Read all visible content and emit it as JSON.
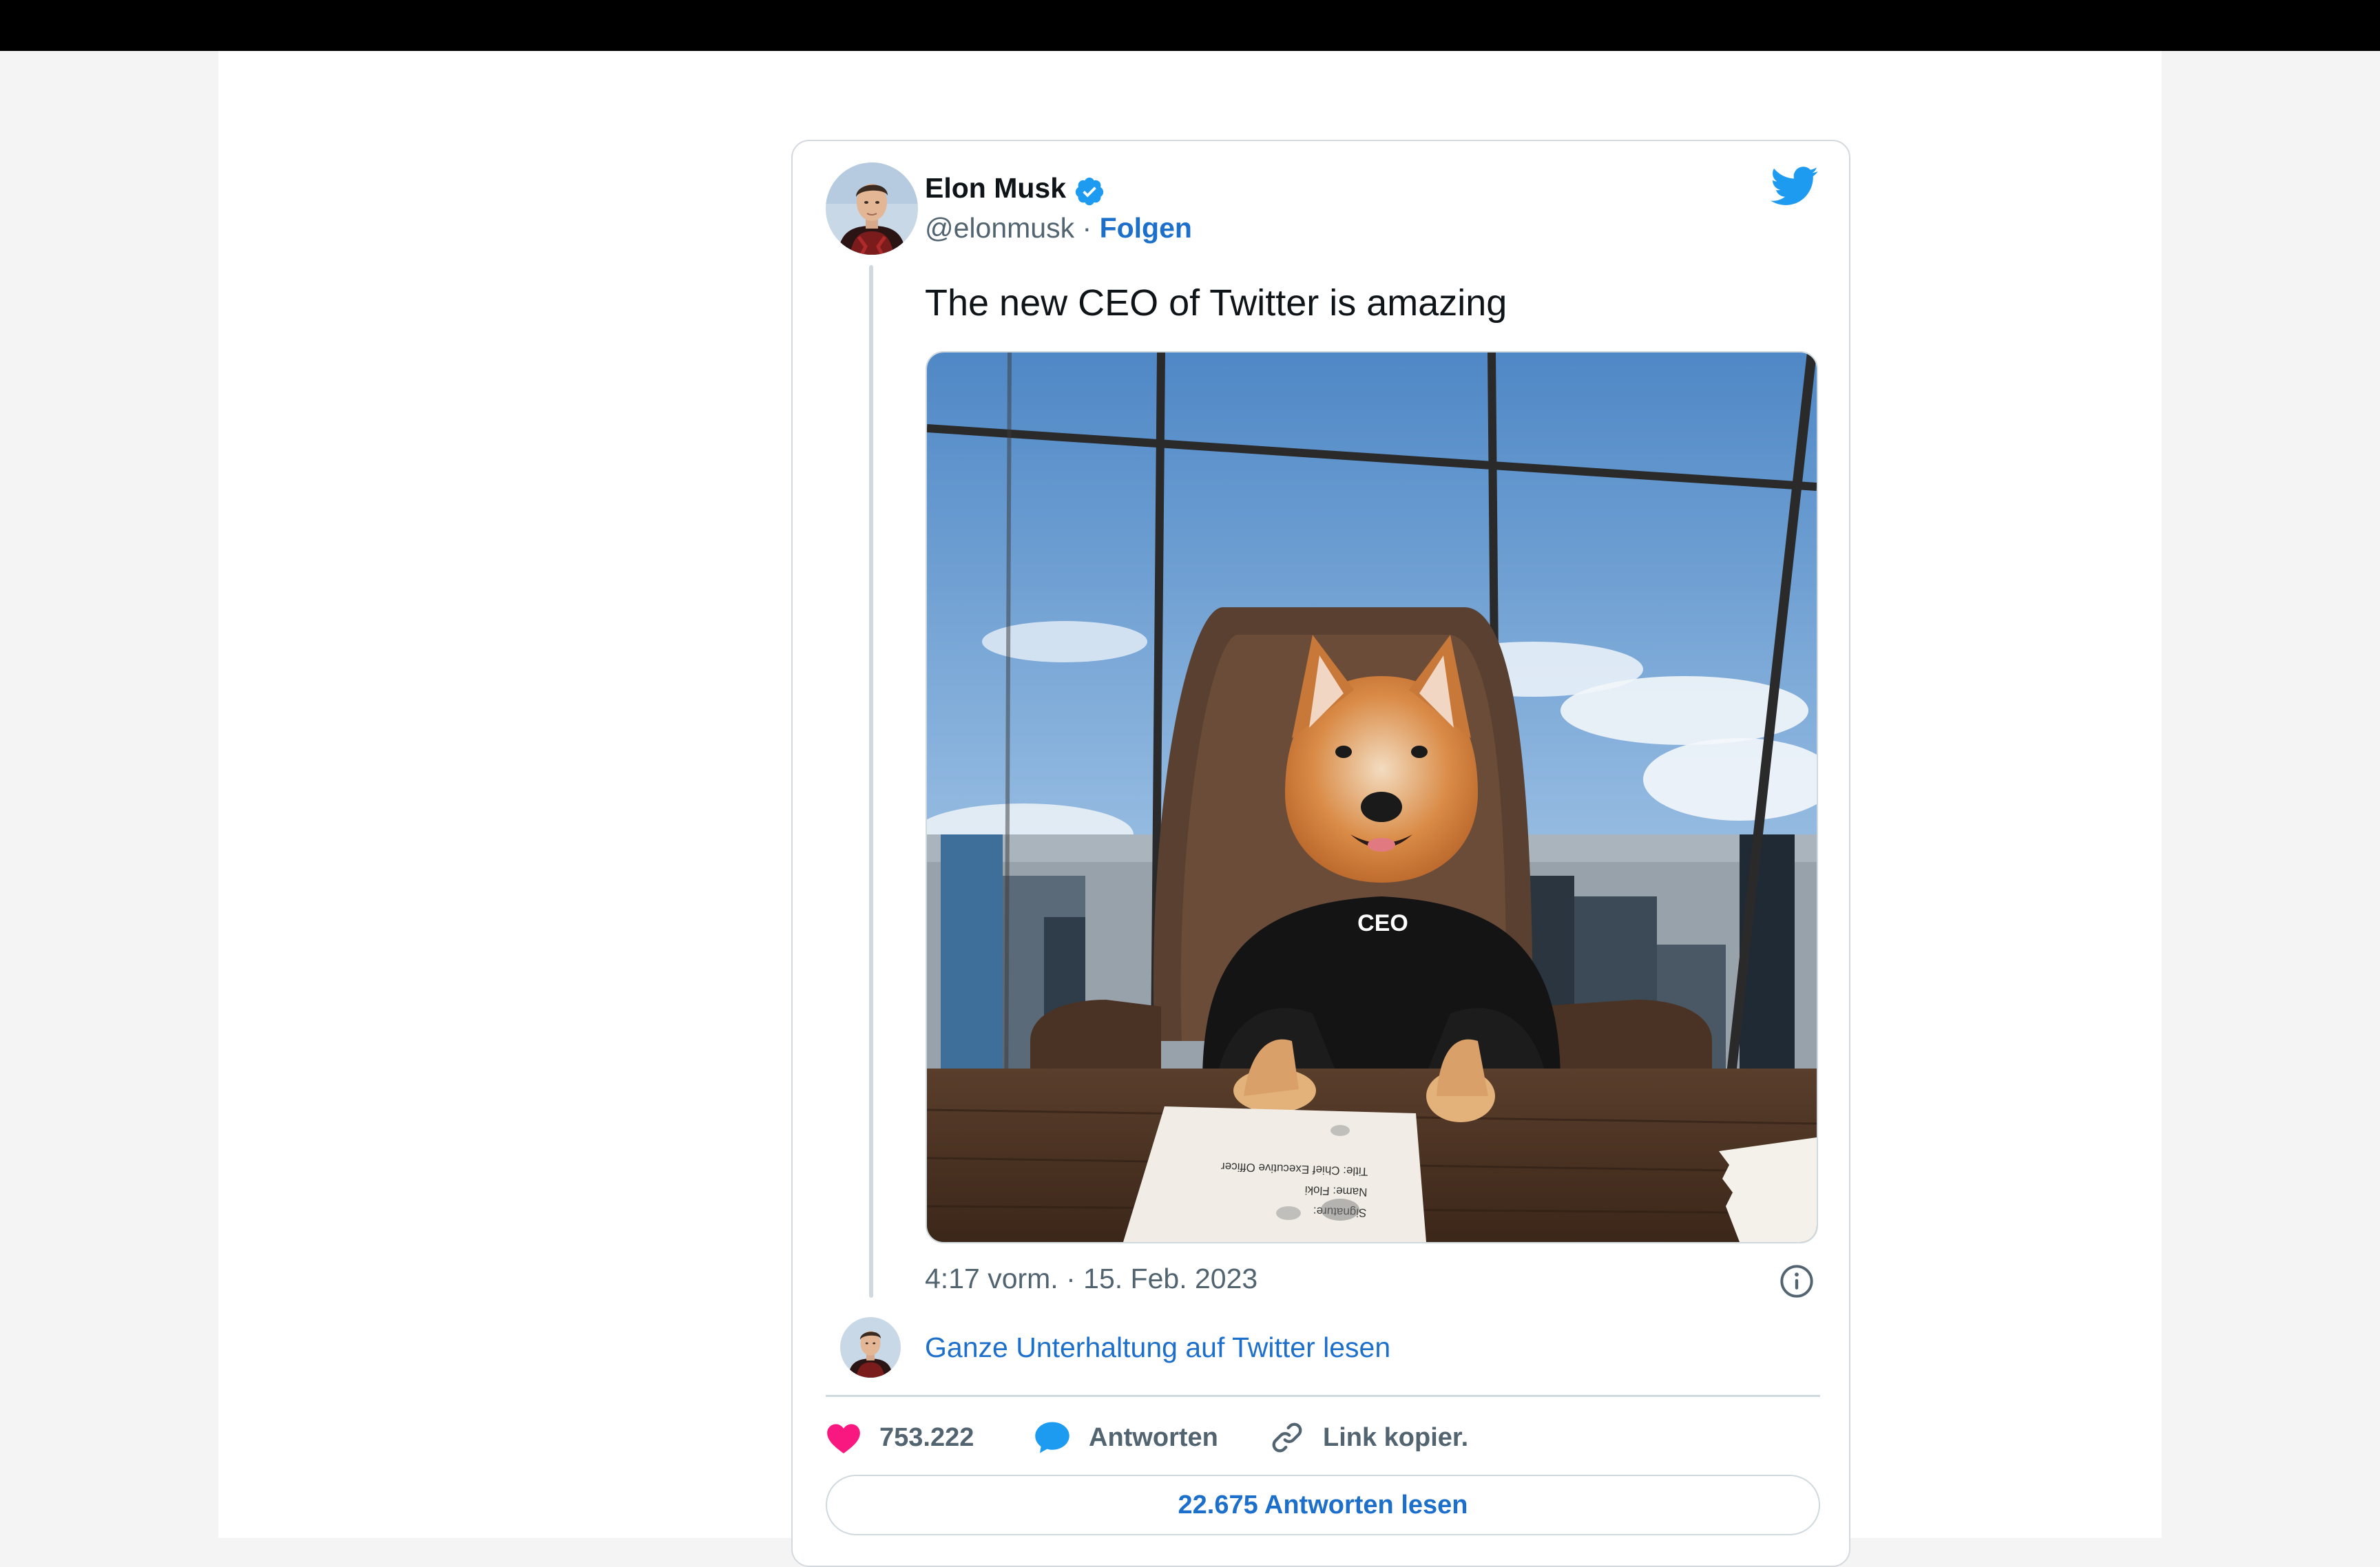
{
  "tweet": {
    "author_name": "Elon Musk",
    "handle": "@elonmusk",
    "separator": "·",
    "follow_label": "Folgen",
    "text": "The new CEO of Twitter is amazing",
    "image": {
      "sweater_text": "CEO",
      "paper_lines": [
        "Signature:",
        "Name:  Floki",
        "Title:  Chief Executive Officer"
      ]
    },
    "time": "4:17 vorm.",
    "date": "15. Feb. 2023",
    "read_conversation_label": "Ganze Unterhaltung auf Twitter lesen",
    "actions": {
      "likes_count": "753.222",
      "reply_label": "Antworten",
      "copy_link_label": "Link kopier."
    },
    "read_replies_label": "22.675 Antworten lesen"
  },
  "icons": {
    "verified": "verified-badge-icon",
    "brand": "twitter-bird-icon",
    "info": "info-icon",
    "like": "heart-icon",
    "reply": "speech-bubble-icon",
    "copy": "link-icon"
  },
  "colors": {
    "link_blue": "#1d6fcc",
    "twitter_blue": "#1d9bf0",
    "heart_pink": "#f91880",
    "secondary_text": "#536471",
    "primary_text": "#0f1419"
  }
}
